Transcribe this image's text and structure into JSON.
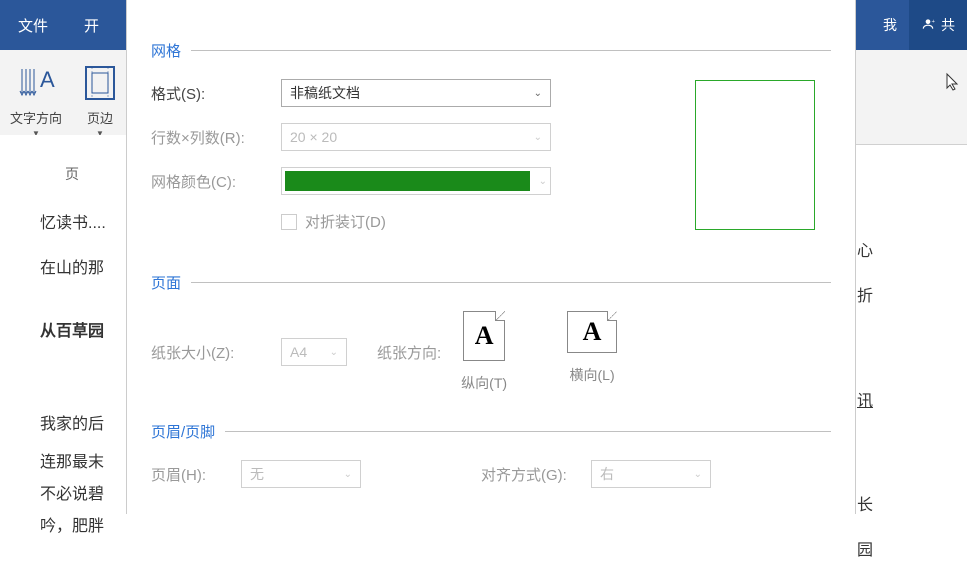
{
  "ribbon": {
    "file": "文件",
    "start_partial": "开",
    "user_partial": "我",
    "share_partial": "共"
  },
  "toolbar": {
    "text_direction": "文字方向",
    "margins": "页边",
    "page_partial": "页"
  },
  "doc_left": {
    "line1": "忆读书....",
    "line2": "在山的那",
    "heading": "从百草园",
    "para1": "我家的后",
    "para2": "连那最末",
    "para3": "不必说碧",
    "para4": "吟，肥胖"
  },
  "doc_right": {
    "r1": "心",
    "r2": "折",
    "r3": "讯",
    "r4": "长",
    "r5": "园"
  },
  "grid": {
    "section_title": "网格",
    "format_label": "格式(S):",
    "format_value": "非稿纸文档",
    "rows_cols_label": "行数×列数(R):",
    "rows_cols_value": "20 × 20",
    "color_label": "网格颜色(C):",
    "color_hex": "#1a8a1a",
    "fold_binding": "对折装订(D)"
  },
  "page": {
    "section_title": "页面",
    "size_label": "纸张大小(Z):",
    "size_value": "A4",
    "orientation_label": "纸张方向:",
    "portrait": "纵向(T)",
    "landscape": "横向(L)"
  },
  "header_footer": {
    "section_title": "页眉/页脚",
    "header_label": "页眉(H):",
    "header_value": "无",
    "align_label": "对齐方式(G):",
    "align_value": "右"
  }
}
